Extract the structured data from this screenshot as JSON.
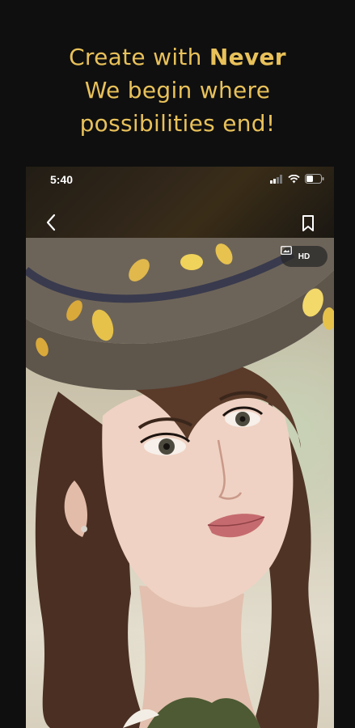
{
  "headline": {
    "line1_prefix": "Create with ",
    "line1_brand": "Never",
    "line2": "We begin where",
    "line3": "possibilities end!"
  },
  "status_bar": {
    "time": "5:40"
  },
  "photo": {
    "badge_label": "HD"
  },
  "colors": {
    "accent": "#e8c15a",
    "background": "#0f0f0f"
  }
}
